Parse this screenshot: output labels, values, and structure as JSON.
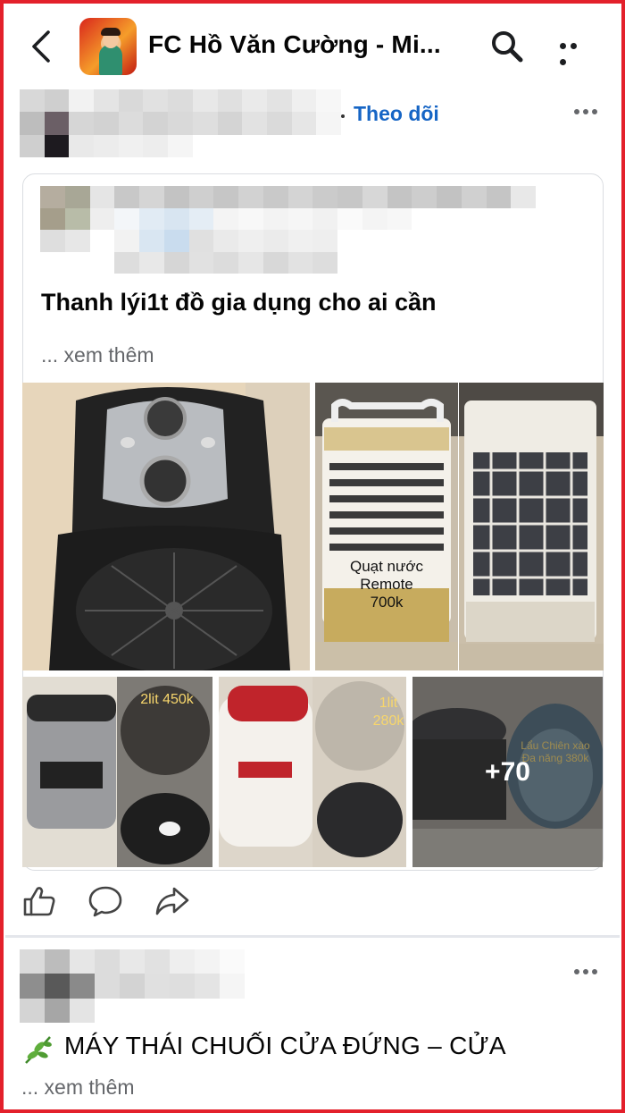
{
  "header": {
    "group_name": "FC Hồ Văn Cường - Mi...",
    "back_icon": "back-arrow-icon",
    "search_icon": "search-icon",
    "more_icon": "more-horizontal-icon"
  },
  "post": {
    "follow_label": "Theo dõi",
    "text": "Thanh lýi1t đồ gia dụng cho ai cần",
    "see_more": "... xem thêm",
    "photos": [
      {
        "caption": ""
      },
      {
        "caption": "Quạt nước Remote 700k"
      },
      {
        "caption": ""
      },
      {
        "caption": "2lit 450k"
      },
      {
        "caption": "1lit 280k"
      },
      {
        "caption": "Lẩu Chiên xào Đa năng 380k"
      }
    ],
    "more_photos": "+70",
    "actions": [
      "like-icon",
      "comment-icon",
      "share-icon"
    ]
  },
  "next_post": {
    "title": "MÁY THÁI CHUỐI CỬA ĐỨNG – CỬA",
    "see_more": "... xem thêm",
    "emoji": "🌿"
  },
  "colors": {
    "accent": "#1665c5",
    "frame": "#e3202b",
    "muted": "#65676b"
  }
}
